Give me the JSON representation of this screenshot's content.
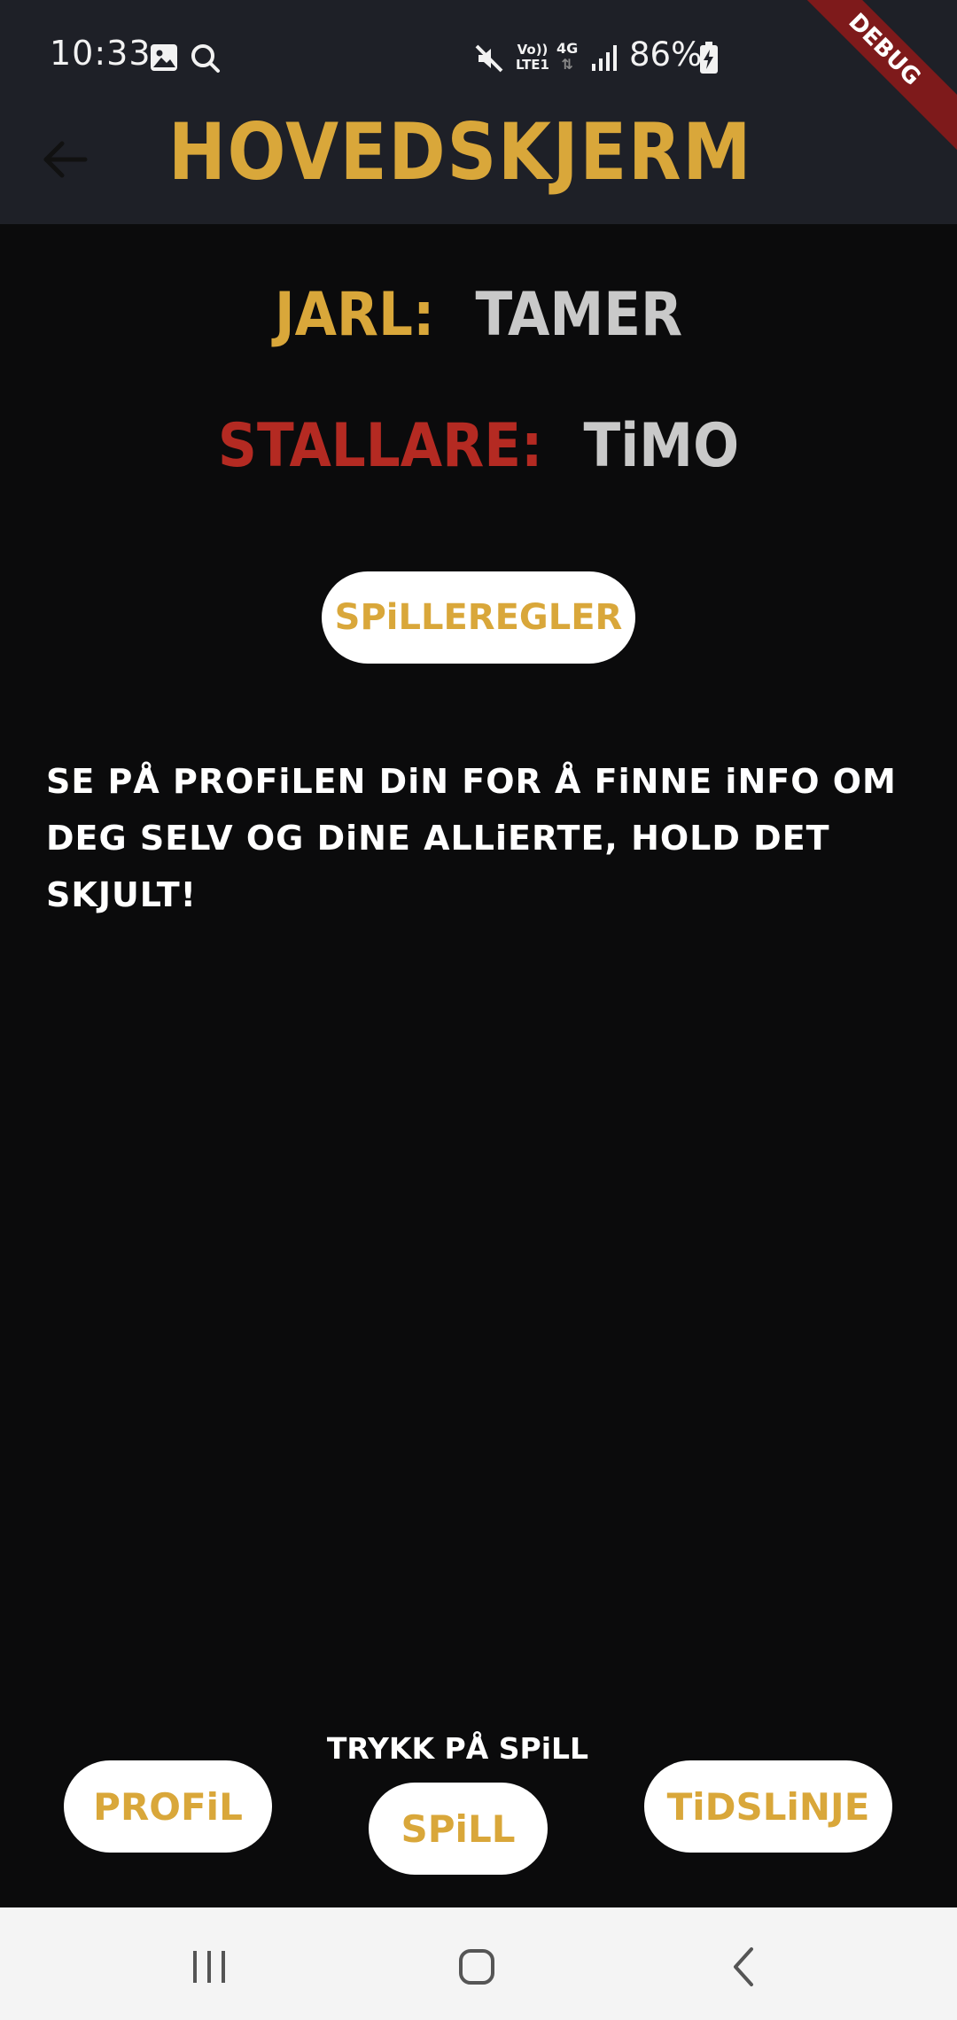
{
  "status_bar": {
    "time": "10:33",
    "battery": "86%",
    "network_top": "Vo))",
    "network_bottom": "LTE1",
    "data_type": "4G"
  },
  "debug_banner": "DEBUG",
  "app_bar": {
    "title": "HOVEDSKJERM"
  },
  "roles": {
    "jarl_label": "JARL:",
    "jarl_value": "TAMER",
    "stallare_label": "STALLARE:",
    "stallare_value": "TiMO"
  },
  "rules_button": "SPiLLEREGLER",
  "info_text": "SE PÅ PROFiLEN DiN FOR Å FiNNE iNFO OM DEG SELV OG DiNE ALLiERTE, HOLD DET SKJULT!",
  "hint_text": "TRYKK PÅ SPiLL",
  "bottom_buttons": {
    "profile": "PROFiL",
    "play": "SPiLL",
    "timeline": "TiDSLiNJE"
  },
  "colors": {
    "gold": "#d9a73a",
    "red": "#b42a22",
    "grey_value": "#c9c9c9",
    "appbar": "#1e2027",
    "background": "#0b0b0c"
  }
}
